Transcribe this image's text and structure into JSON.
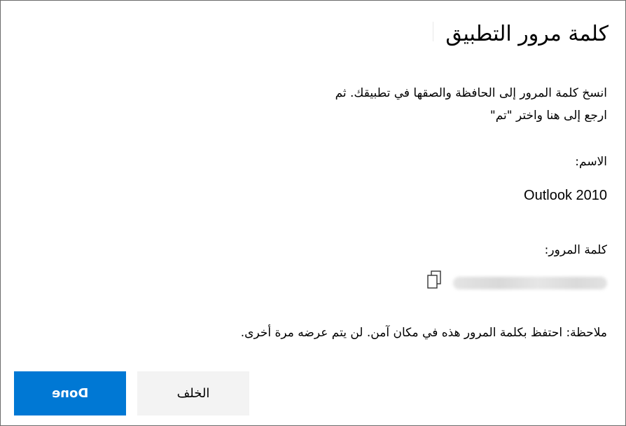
{
  "dialog": {
    "title": "كلمة مرور التطبيق",
    "instructions": "انسخ كلمة المرور إلى الحافظة والصقها في تطبيقك. ثم ارجع إلى هنا واختر \"تم\"",
    "name_label": "الاسم:",
    "name_value": "Outlook 2010",
    "password_label": "كلمة المرور:",
    "copy_icon": "copy-icon",
    "note": "ملاحظة: احتفظ بكلمة المرور هذه في مكان آمن. لن يتم عرضه مرة أخرى."
  },
  "buttons": {
    "back_label": "الخلف",
    "done_label": "Done"
  },
  "colors": {
    "primary": "#0078d4",
    "secondary_button": "#f3f3f3",
    "border": "#6b6b6b"
  }
}
